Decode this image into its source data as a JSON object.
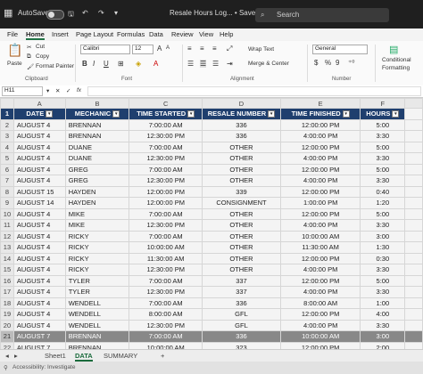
{
  "titlebar": {
    "autosave": "AutoSave",
    "filename": "Resale Hours Log... • Saved",
    "search": "Search"
  },
  "menus": [
    "File",
    "Home",
    "Insert",
    "Page Layout",
    "Formulas",
    "Data",
    "Review",
    "View",
    "Help"
  ],
  "ribbon": {
    "paste": "Paste",
    "cut": "Cut",
    "copy": "Copy",
    "format_painter": "Format Painter",
    "clipboard": "Clipboard",
    "font_name": "Calibri",
    "font_size": "12",
    "font_group": "Font",
    "bold": "B",
    "italic": "I",
    "underline": "U",
    "grow": "A",
    "shrink": "A",
    "wrap_text": "Wrap Text",
    "merge_center": "Merge & Center",
    "alignment": "Alignment",
    "number_format": "General",
    "currency": "$",
    "percent": "%",
    "comma": "9",
    "number": "Number",
    "conditional": "Conditional",
    "formatting": "Formatting"
  },
  "formula_bar": {
    "name_box": "H11",
    "fx": "fx"
  },
  "columns": [
    "A",
    "B",
    "C",
    "D",
    "E",
    "F"
  ],
  "headers": [
    "DATE",
    "MECHANIC",
    "TIME STARTED",
    "RESALE NUMBER",
    "TIME FINISHED",
    "HOURS"
  ],
  "row_numbers": [
    "1",
    "2",
    "3",
    "4",
    "5",
    "6",
    "7",
    "8",
    "9",
    "10",
    "11",
    "12",
    "13",
    "14",
    "15",
    "16",
    "17",
    "18",
    "19",
    "20",
    "21",
    "22"
  ],
  "rows": [
    [
      "AUGUST 4",
      "BRENNAN",
      "7:00:00 AM",
      "336",
      "12:00:00 PM",
      "5:00"
    ],
    [
      "AUGUST 4",
      "BRENNAN",
      "12:30:00 PM",
      "336",
      "4:00:00 PM",
      "3:30"
    ],
    [
      "AUGUST 4",
      "DUANE",
      "7:00:00 AM",
      "OTHER",
      "12:00:00 PM",
      "5:00"
    ],
    [
      "AUGUST 4",
      "DUANE",
      "12:30:00 PM",
      "OTHER",
      "4:00:00 PM",
      "3:30"
    ],
    [
      "AUGUST 4",
      "GREG",
      "7:00:00 AM",
      "OTHER",
      "12:00:00 PM",
      "5:00"
    ],
    [
      "AUGUST 4",
      "GREG",
      "12:30:00 PM",
      "OTHER",
      "4:00:00 PM",
      "3:30"
    ],
    [
      "AUGUST 15",
      "HAYDEN",
      "12:00:00 PM",
      "339",
      "12:00:00 PM",
      "0:40"
    ],
    [
      "AUGUST 14",
      "HAYDEN",
      "12:00:00 PM",
      "CONSIGNMENT",
      "1:00:00 PM",
      "1:20"
    ],
    [
      "AUGUST 4",
      "MIKE",
      "7:00:00 AM",
      "OTHER",
      "12:00:00 PM",
      "5:00"
    ],
    [
      "AUGUST 4",
      "MIKE",
      "12:30:00 PM",
      "OTHER",
      "4:00:00 PM",
      "3:30"
    ],
    [
      "AUGUST 4",
      "RICKY",
      "7:00:00 AM",
      "OTHER",
      "10:00:00 AM",
      "3:00"
    ],
    [
      "AUGUST 4",
      "RICKY",
      "10:00:00 AM",
      "OTHER",
      "11:30:00 AM",
      "1:30"
    ],
    [
      "AUGUST 4",
      "RICKY",
      "11:30:00 AM",
      "OTHER",
      "12:00:00 PM",
      "0:30"
    ],
    [
      "AUGUST 4",
      "RICKY",
      "12:30:00 PM",
      "OTHER",
      "4:00:00 PM",
      "3:30"
    ],
    [
      "AUGUST 4",
      "TYLER",
      "7:00:00 AM",
      "337",
      "12:00:00 PM",
      "5:00"
    ],
    [
      "AUGUST 4",
      "TYLER",
      "12:30:00 PM",
      "337",
      "4:00:00 PM",
      "3:30"
    ],
    [
      "AUGUST 4",
      "WENDELL",
      "7:00:00 AM",
      "336",
      "8:00:00 AM",
      "1:00"
    ],
    [
      "AUGUST 4",
      "WENDELL",
      "8:00:00 AM",
      "GFL",
      "12:00:00 PM",
      "4:00"
    ],
    [
      "AUGUST 4",
      "WENDELL",
      "12:30:00 PM",
      "GFL",
      "4:00:00 PM",
      "3:30"
    ],
    [
      "AUGUST 7",
      "BRENNAN",
      "7:00:00 AM",
      "336",
      "10:00:00 AM",
      "3:00"
    ],
    [
      "AUGUST 7",
      "BRENNAN",
      "10:00:00 AM",
      "323",
      "12:00:00 PM",
      "2:00"
    ]
  ],
  "sheet_tabs": [
    "Sheet1",
    "DATA",
    "SUMMARY"
  ],
  "add_sheet": "+",
  "status": "Accessibility: Investigate"
}
